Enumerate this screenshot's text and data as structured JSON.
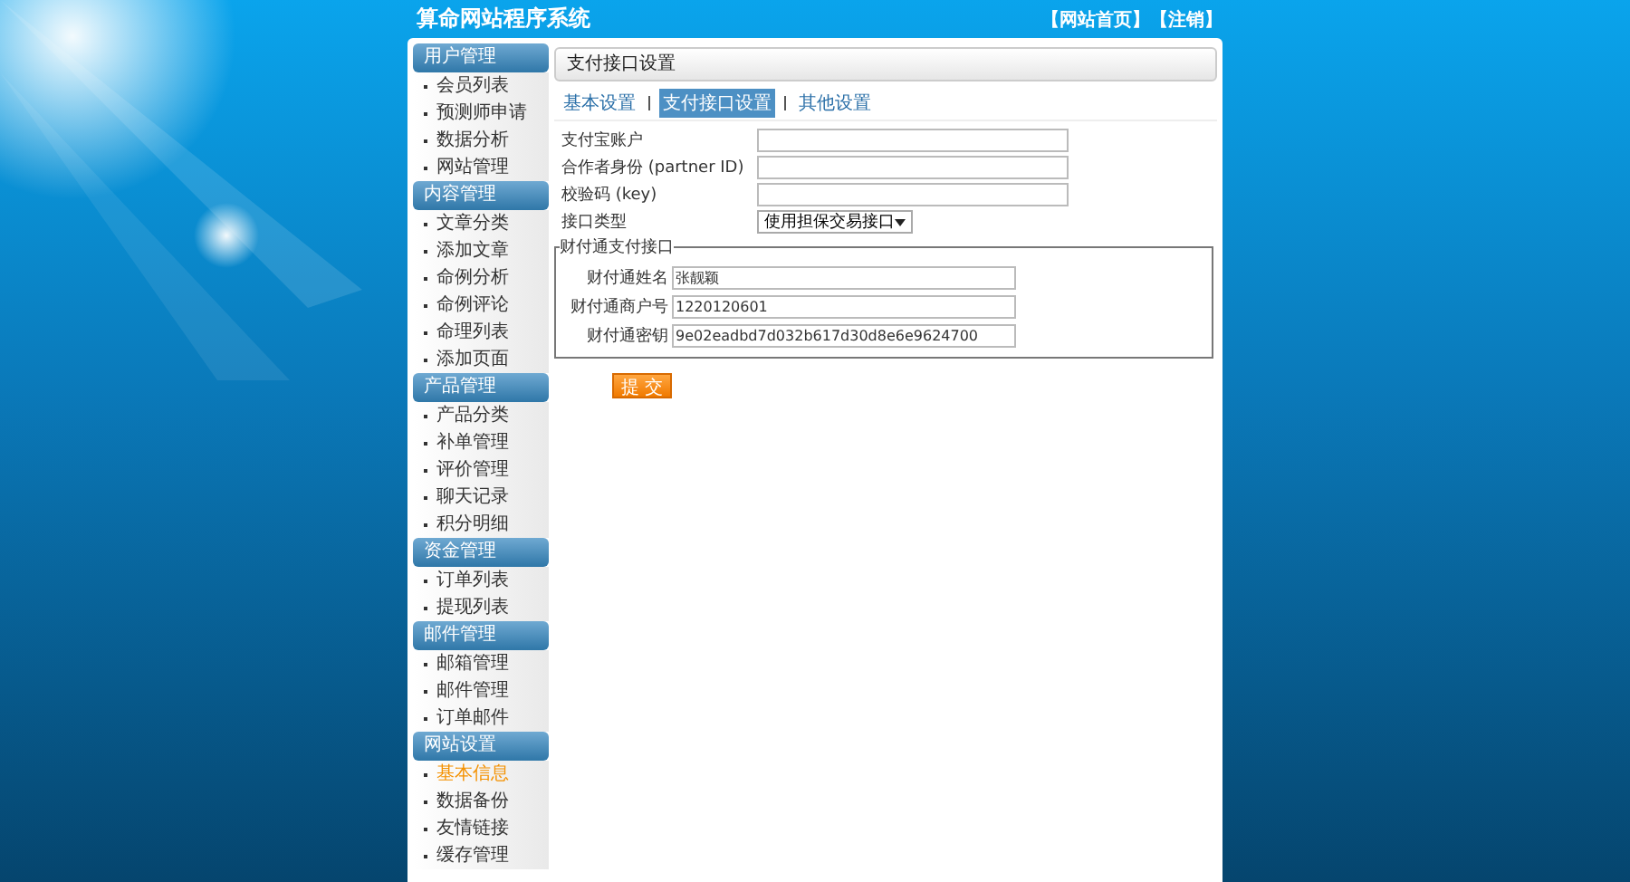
{
  "header": {
    "title": "算命网站程序系统",
    "links": [
      "【网站首页】",
      "【注销】"
    ]
  },
  "sidebar": [
    {
      "title": "用户管理",
      "items": [
        {
          "label": "会员列表",
          "selected": false
        },
        {
          "label": "预测师申请",
          "selected": false
        },
        {
          "label": "数据分析",
          "selected": false
        },
        {
          "label": "网站管理",
          "selected": false
        }
      ]
    },
    {
      "title": "内容管理",
      "items": [
        {
          "label": "文章分类",
          "selected": false
        },
        {
          "label": "添加文章",
          "selected": false
        },
        {
          "label": "命例分析",
          "selected": false
        },
        {
          "label": "命例评论",
          "selected": false
        },
        {
          "label": "命理列表",
          "selected": false
        },
        {
          "label": "添加页面",
          "selected": false
        }
      ]
    },
    {
      "title": "产品管理",
      "items": [
        {
          "label": "产品分类",
          "selected": false
        },
        {
          "label": "补单管理",
          "selected": false
        },
        {
          "label": "评价管理",
          "selected": false
        },
        {
          "label": "聊天记录",
          "selected": false
        },
        {
          "label": "积分明细",
          "selected": false
        }
      ]
    },
    {
      "title": "资金管理",
      "items": [
        {
          "label": "订单列表",
          "selected": false
        },
        {
          "label": "提现列表",
          "selected": false
        }
      ]
    },
    {
      "title": "邮件管理",
      "items": [
        {
          "label": "邮箱管理",
          "selected": false
        },
        {
          "label": "邮件管理",
          "selected": false
        },
        {
          "label": "订单邮件",
          "selected": false
        }
      ]
    },
    {
      "title": "网站设置",
      "items": [
        {
          "label": "基本信息",
          "selected": true
        },
        {
          "label": "数据备份",
          "selected": false
        },
        {
          "label": "友情链接",
          "selected": false
        },
        {
          "label": "缓存管理",
          "selected": false
        }
      ]
    }
  ],
  "panel": {
    "title": "支付接口设置",
    "tabs": [
      {
        "label": "基本设置",
        "selected": false
      },
      {
        "label": "支付接口设置",
        "selected": true
      },
      {
        "label": "其他设置",
        "selected": false
      }
    ],
    "fields": [
      {
        "kind": "text",
        "label": "支付宝账户"
      },
      {
        "kind": "text",
        "label": "合作者身份 (partner ID)"
      },
      {
        "kind": "text",
        "label": "校验码 (key)"
      },
      {
        "kind": "select",
        "label": "接口类型",
        "value": "使用担保交易接口"
      }
    ],
    "group": {
      "legend": "财付通支付接口",
      "fields": [
        {
          "label": "财付通姓名",
          "value": "张靓颖"
        },
        {
          "label": "财付通商户号",
          "value": "1220120601"
        },
        {
          "label": "财付通密钥",
          "value": "9e02eadbd7d032b617d30d8e6e9624700"
        }
      ]
    },
    "submit": "提 交"
  }
}
